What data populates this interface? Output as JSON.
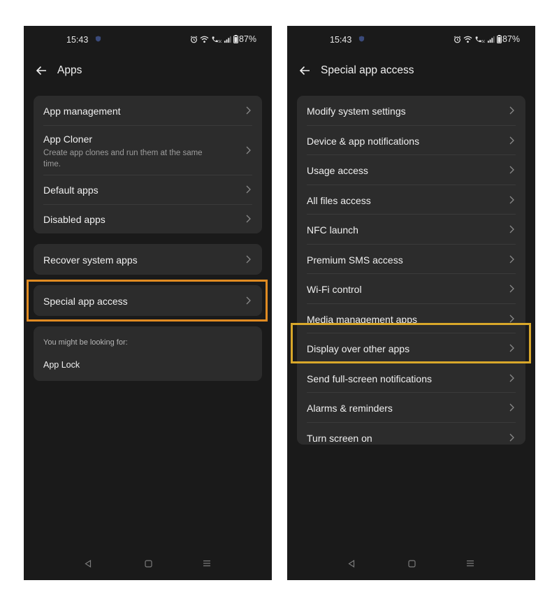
{
  "left": {
    "status": {
      "time": "15:43",
      "battery": "87%"
    },
    "title": "Apps",
    "group1": [
      {
        "label": "App management"
      },
      {
        "label": "App Cloner",
        "subtitle": "Create app clones and run them at the same time."
      },
      {
        "label": "Default apps"
      },
      {
        "label": "Disabled apps"
      }
    ],
    "group2": [
      {
        "label": "Recover system apps"
      }
    ],
    "group3": [
      {
        "label": "Special app access"
      }
    ],
    "suggestions": {
      "title": "You might be looking for:",
      "item": "App Lock"
    }
  },
  "right": {
    "status": {
      "time": "15:43",
      "battery": "87%"
    },
    "title": "Special app access",
    "items": [
      "Modify system settings",
      "Device & app notifications",
      "Usage access",
      "All files access",
      "NFC launch",
      "Premium SMS access",
      "Wi-Fi control",
      "Media management apps",
      "Display over other apps",
      "Send full-screen notifications",
      "Alarms & reminders",
      "Turn screen on"
    ]
  },
  "colors": {
    "highlight": "#d8a72a",
    "highlight_orange": "#e08b22",
    "card": "#2c2c2c",
    "screen": "#1a1a1a"
  },
  "icons": [
    "back-arrow-icon",
    "chevron-right-icon",
    "alarm-icon",
    "wifi-icon",
    "volte-icon",
    "signal-icon",
    "battery-icon",
    "vpn-shield-icon",
    "nav-back-icon",
    "nav-home-icon",
    "nav-recents-icon"
  ]
}
